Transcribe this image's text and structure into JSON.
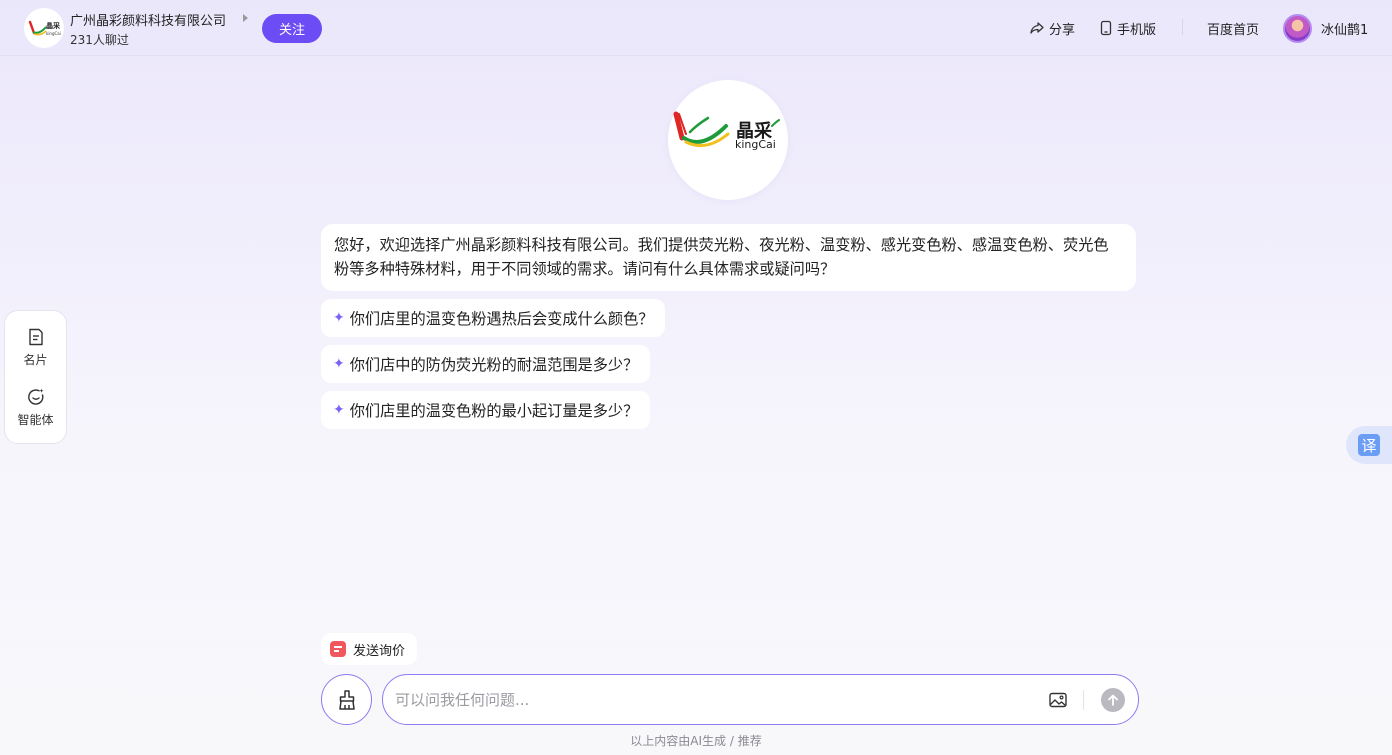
{
  "header": {
    "shop_name": "广州晶彩颜料科技有限公司",
    "shop_visitors": "231人聊过",
    "follow_label": "关注",
    "share_label": "分享",
    "mobile_label": "手机版",
    "baidu_home_label": "百度首页",
    "user_name": "冰仙鹊1"
  },
  "logo": {
    "brand_cn": "晶采",
    "brand_en": "kingCai"
  },
  "chat": {
    "greeting": "您好，欢迎选择广州晶彩颜料科技有限公司。我们提供荧光粉、夜光粉、温变粉、感光变色粉、感温变色粉、荧光色粉等多种特殊材料，用于不同领域的需求。请问有什么具体需求或疑问吗？",
    "suggestions": [
      "你们店里的温变色粉遇热后会变成什么颜色？",
      "你们店中的防伪荧光粉的耐温范围是多少？",
      "你们店里的温变色粉的最小起订量是多少？"
    ]
  },
  "side_panel": {
    "card_label": "名片",
    "agent_label": "智能体"
  },
  "translate_label": "译",
  "bottom": {
    "inquiry_label": "发送询价",
    "input_placeholder": "可以问我任何问题...",
    "footer_note": "以上内容由AI生成 / 推荐"
  },
  "colors": {
    "accent": "#6b4cf5",
    "input_border": "#8d7cf2",
    "inquiry_icon": "#f0585d",
    "translate_icon": "#6c9df5"
  },
  "icons": [
    "share-icon",
    "mobile-icon",
    "card-icon",
    "agent-icon",
    "sparkle-icon",
    "brush-icon",
    "image-icon",
    "send-arrow-icon"
  ]
}
